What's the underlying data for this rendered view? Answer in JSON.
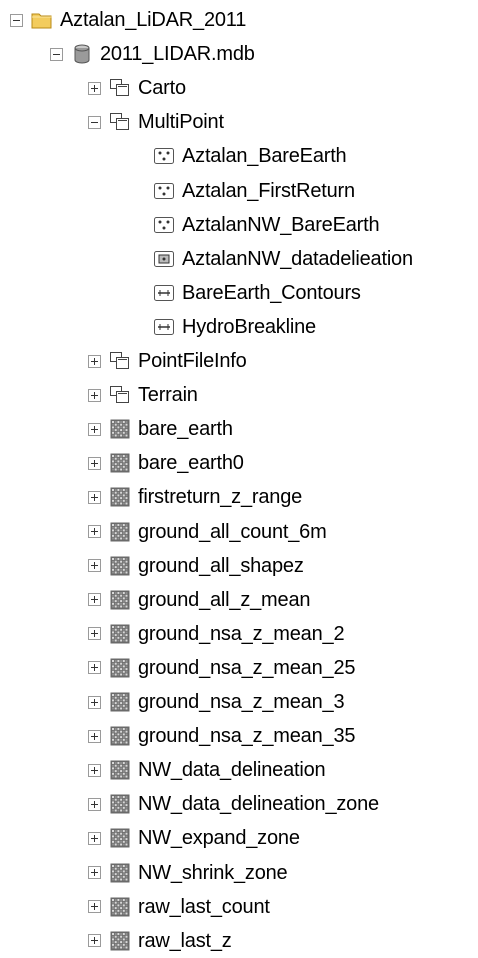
{
  "tree": [
    {
      "label": "Aztalan_LiDAR_2011",
      "icon": "folder-icon",
      "toggle": "minus",
      "level": 0,
      "name": "tree-item-aztalan-lidar-2011"
    },
    {
      "label": "2011_LIDAR.mdb",
      "icon": "geodatabase-icon",
      "toggle": "minus",
      "level": 1,
      "name": "tree-item-2011-lidar-mdb"
    },
    {
      "label": "Carto",
      "icon": "feature-dataset-icon",
      "toggle": "plus",
      "level": 2,
      "name": "tree-item-carto"
    },
    {
      "label": "MultiPoint",
      "icon": "feature-dataset-icon",
      "toggle": "minus",
      "level": 2,
      "name": "tree-item-multipoint"
    },
    {
      "label": "Aztalan_BareEarth",
      "icon": "multipoint-feature-class-icon",
      "toggle": "none",
      "level": 3,
      "name": "tree-item-aztalan-bareearth"
    },
    {
      "label": "Aztalan_FirstReturn",
      "icon": "multipoint-feature-class-icon",
      "toggle": "none",
      "level": 3,
      "name": "tree-item-aztalan-firstreturn"
    },
    {
      "label": "AztalanNW_BareEarth",
      "icon": "multipoint-feature-class-icon",
      "toggle": "none",
      "level": 3,
      "name": "tree-item-aztalannw-bareearth"
    },
    {
      "label": "AztalanNW_datadelieation",
      "icon": "polygon-feature-class-icon",
      "toggle": "none",
      "level": 3,
      "name": "tree-item-aztalannw-datadelieation"
    },
    {
      "label": "BareEarth_Contours",
      "icon": "line-feature-class-icon",
      "toggle": "none",
      "level": 3,
      "name": "tree-item-bareearth-contours"
    },
    {
      "label": "HydroBreakline",
      "icon": "line-feature-class-icon",
      "toggle": "none",
      "level": 3,
      "name": "tree-item-hydrobreakline"
    },
    {
      "label": "PointFileInfo",
      "icon": "feature-dataset-icon",
      "toggle": "plus",
      "level": 2,
      "name": "tree-item-pointfileinfo"
    },
    {
      "label": "Terrain",
      "icon": "feature-dataset-icon",
      "toggle": "plus",
      "level": 2,
      "name": "tree-item-terrain"
    },
    {
      "label": "bare_earth",
      "icon": "raster-dataset-icon",
      "toggle": "plus",
      "level": 2,
      "name": "tree-item-bare-earth"
    },
    {
      "label": "bare_earth0",
      "icon": "raster-dataset-icon",
      "toggle": "plus",
      "level": 2,
      "name": "tree-item-bare-earth0"
    },
    {
      "label": "firstreturn_z_range",
      "icon": "raster-dataset-icon",
      "toggle": "plus",
      "level": 2,
      "name": "tree-item-firstreturn-z-range"
    },
    {
      "label": "ground_all_count_6m",
      "icon": "raster-dataset-icon",
      "toggle": "plus",
      "level": 2,
      "name": "tree-item-ground-all-count-6m"
    },
    {
      "label": "ground_all_shapez",
      "icon": "raster-dataset-icon",
      "toggle": "plus",
      "level": 2,
      "name": "tree-item-ground-all-shapez"
    },
    {
      "label": "ground_all_z_mean",
      "icon": "raster-dataset-icon",
      "toggle": "plus",
      "level": 2,
      "name": "tree-item-ground-all-z-mean"
    },
    {
      "label": "ground_nsa_z_mean_2",
      "icon": "raster-dataset-icon",
      "toggle": "plus",
      "level": 2,
      "name": "tree-item-ground-nsa-z-mean-2"
    },
    {
      "label": "ground_nsa_z_mean_25",
      "icon": "raster-dataset-icon",
      "toggle": "plus",
      "level": 2,
      "name": "tree-item-ground-nsa-z-mean-25"
    },
    {
      "label": "ground_nsa_z_mean_3",
      "icon": "raster-dataset-icon",
      "toggle": "plus",
      "level": 2,
      "name": "tree-item-ground-nsa-z-mean-3"
    },
    {
      "label": "ground_nsa_z_mean_35",
      "icon": "raster-dataset-icon",
      "toggle": "plus",
      "level": 2,
      "name": "tree-item-ground-nsa-z-mean-35"
    },
    {
      "label": "NW_data_delineation",
      "icon": "raster-dataset-icon",
      "toggle": "plus",
      "level": 2,
      "name": "tree-item-nw-data-delineation"
    },
    {
      "label": "NW_data_delineation_zone",
      "icon": "raster-dataset-icon",
      "toggle": "plus",
      "level": 2,
      "name": "tree-item-nw-data-delineation-zone"
    },
    {
      "label": "NW_expand_zone",
      "icon": "raster-dataset-icon",
      "toggle": "plus",
      "level": 2,
      "name": "tree-item-nw-expand-zone"
    },
    {
      "label": "NW_shrink_zone",
      "icon": "raster-dataset-icon",
      "toggle": "plus",
      "level": 2,
      "name": "tree-item-nw-shrink-zone"
    },
    {
      "label": "raw_last_count",
      "icon": "raster-dataset-icon",
      "toggle": "plus",
      "level": 2,
      "name": "tree-item-raw-last-count"
    },
    {
      "label": "raw_last_z",
      "icon": "raster-dataset-icon",
      "toggle": "plus",
      "level": 2,
      "name": "tree-item-raw-last-z"
    }
  ]
}
